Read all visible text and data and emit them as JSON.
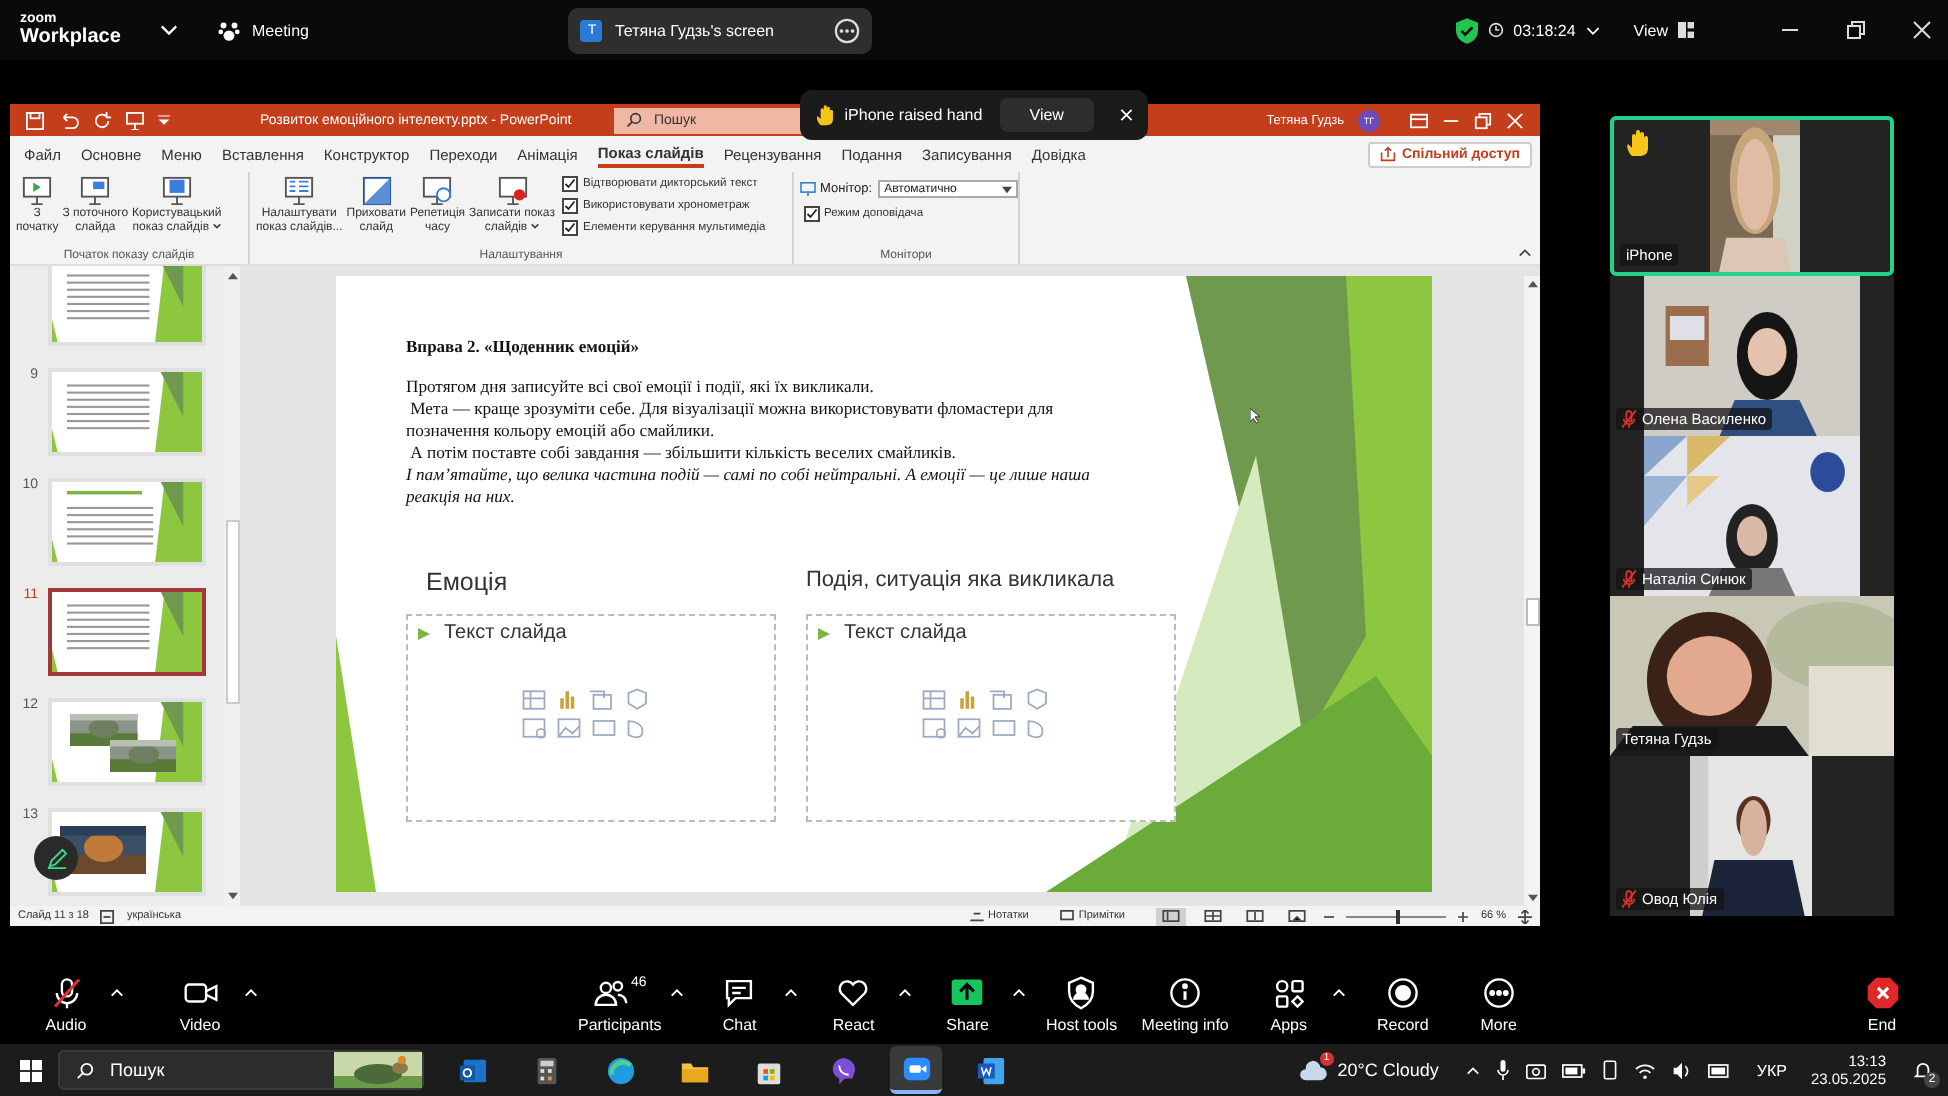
{
  "zoom_header": {
    "logo_top": "zoom",
    "logo_bottom": "Workplace",
    "meeting": "Meeting",
    "share_badge": "T",
    "share_title": "Тетяна Гудзь's screen",
    "timer": "03:18:24",
    "view": "View"
  },
  "raised_hand_notice": {
    "text": "iPhone raised hand",
    "button": "View"
  },
  "powerpoint": {
    "title": "Розвиток емоційного інтелекту.pptx - PowerPoint",
    "search_placeholder": "Пошук",
    "user_name": "Тетяна Гудзь",
    "user_initials": "ТГ",
    "tabs": [
      {
        "label": "Файл",
        "selected": false
      },
      {
        "label": "Основне",
        "selected": false
      },
      {
        "label": "Меню",
        "selected": false
      },
      {
        "label": "Вставлення",
        "selected": false
      },
      {
        "label": "Конструктор",
        "selected": false
      },
      {
        "label": "Переходи",
        "selected": false
      },
      {
        "label": "Анімація",
        "selected": false
      },
      {
        "label": "Показ слайдів",
        "selected": true
      },
      {
        "label": "Рецензування",
        "selected": false
      },
      {
        "label": "Подання",
        "selected": false
      },
      {
        "label": "Записування",
        "selected": false
      },
      {
        "label": "Довідка",
        "selected": false
      }
    ],
    "share_button": "Спільний доступ",
    "ribbon_groups": [
      {
        "label": "Початок показу слайдів",
        "items": [
          {
            "kind": "button",
            "label": "З\nпочатку",
            "has_menu": false
          },
          {
            "kind": "button",
            "label": "З поточного\nслайда",
            "has_menu": false
          },
          {
            "kind": "button",
            "label": "Користувацький\nпоказ слайдів",
            "has_menu": true
          }
        ]
      },
      {
        "label": "Налаштування",
        "items": [
          {
            "kind": "button",
            "label": "Налаштувати\nпоказ слайдів...",
            "has_menu": false
          },
          {
            "kind": "button",
            "label": "Приховати\nслайд",
            "has_menu": false
          },
          {
            "kind": "button",
            "label": "Репетиція\nчасу",
            "has_menu": false
          },
          {
            "kind": "button",
            "label": "Записати показ\nслайдів",
            "has_menu": true
          },
          {
            "kind": "checkboxes",
            "options": [
              {
                "label": "Відтворювати дикторський текст",
                "checked": true
              },
              {
                "label": "Використовувати хронометраж",
                "checked": true
              },
              {
                "label": "Елементи керування мультимедіа",
                "checked": true
              }
            ]
          }
        ]
      },
      {
        "label": "Монітори",
        "items": [
          {
            "kind": "monitor",
            "label": "Монітор:",
            "value": "Автоматично"
          },
          {
            "kind": "checkboxes",
            "options": [
              {
                "label": "Режим доповідача",
                "checked": true
              }
            ]
          }
        ]
      }
    ],
    "thumbnails": [
      {
        "kind": "text",
        "selected": false
      },
      {
        "number": "9",
        "kind": "text",
        "selected": false
      },
      {
        "number": "10",
        "kind": "title",
        "selected": false
      },
      {
        "number": "11",
        "kind": "text",
        "selected": true
      },
      {
        "number": "12",
        "kind": "photos",
        "selected": false
      },
      {
        "number": "13",
        "selected": false
      }
    ],
    "slide": {
      "heading": "Вправа 2. «Щоденник емоцій»",
      "paragraphs": [
        {
          "text": "Протягом дня записуйте всі свої емоції і події, які їх викликали.",
          "italic": false
        },
        {
          "text": " Мета — краще зрозуміти себе. Для візуалізації можна використовувати фломастери для позначення кольору емоцій або смайлики.",
          "italic": false
        },
        {
          "text": " А потім поставте собі завдання — збільшити кількість веселих смайликів.",
          "italic": false
        },
        {
          "text": "І пам’ятайте, що велика частина подій — самі по собі нейтральні. А емоції — це лише наша реакція на них.",
          "italic": true
        }
      ],
      "columns": [
        {
          "title": "Емоція",
          "placeholder": "Текст слайда"
        },
        {
          "title": "Подія, ситуація яка викликала",
          "placeholder": "Текст слайда"
        }
      ]
    },
    "status_bar": {
      "slide_counter": "Слайд 11 з 18",
      "language": "українська",
      "notes": "Нотатки",
      "comments": "Примітки",
      "view_buttons": [
        {
          "selected": true
        },
        {
          "selected": false
        },
        {
          "selected": false
        },
        {
          "selected": false
        }
      ],
      "zoom_slider": {
        "level": 0.5
      },
      "zoom": "66 %"
    }
  },
  "participants": [
    {
      "name": "iPhone",
      "muted": false,
      "raised_hand": true,
      "speaking": true
    },
    {
      "name": "Олена Василенко",
      "muted": true,
      "raised_hand": false,
      "speaking": false
    },
    {
      "name": "Наталія Синюк",
      "muted": true,
      "raised_hand": false,
      "speaking": false
    },
    {
      "name": "Тетяна Гудзь",
      "muted": false,
      "raised_hand": false,
      "speaking": false
    },
    {
      "name": "Овод Юлія",
      "muted": true,
      "raised_hand": false,
      "speaking": false
    }
  ],
  "toolbar": [
    {
      "kind": "audio",
      "label": "Audio",
      "muted": true,
      "has_menu": true
    },
    {
      "kind": "video",
      "label": "Video",
      "has_menu": true
    },
    {
      "kind": "participants",
      "label": "Participants",
      "count": "46",
      "has_menu": true
    },
    {
      "kind": "chat",
      "label": "Chat",
      "has_menu": true
    },
    {
      "kind": "react",
      "label": "React",
      "has_menu": true
    },
    {
      "kind": "share",
      "label": "Share",
      "has_menu": true
    },
    {
      "kind": "host",
      "label": "Host tools",
      "has_menu": false
    },
    {
      "kind": "info",
      "label": "Meeting info",
      "has_menu": false
    },
    {
      "kind": "apps",
      "label": "Apps",
      "has_menu": true
    },
    {
      "kind": "record",
      "label": "Record",
      "has_menu": false
    },
    {
      "kind": "more",
      "label": "More",
      "has_menu": false
    },
    {
      "kind": "end",
      "label": "End",
      "has_menu": false
    }
  ],
  "taskbar": {
    "search_placeholder": "Пошук",
    "apps": [
      {
        "kind": "mail",
        "selected": false
      },
      {
        "kind": "calculator",
        "selected": false
      },
      {
        "kind": "browser",
        "selected": false
      },
      {
        "kind": "folder",
        "selected": false
      },
      {
        "kind": "store",
        "selected": false
      },
      {
        "kind": "phone",
        "selected": false
      },
      {
        "kind": "meeting",
        "selected": true
      },
      {
        "kind": "document",
        "selected": false
      }
    ],
    "weather_badge": "1",
    "weather": "20°C Cloudy",
    "language": "УКР",
    "time": "13:13",
    "date": "23.05.2025",
    "notifications": "2"
  }
}
